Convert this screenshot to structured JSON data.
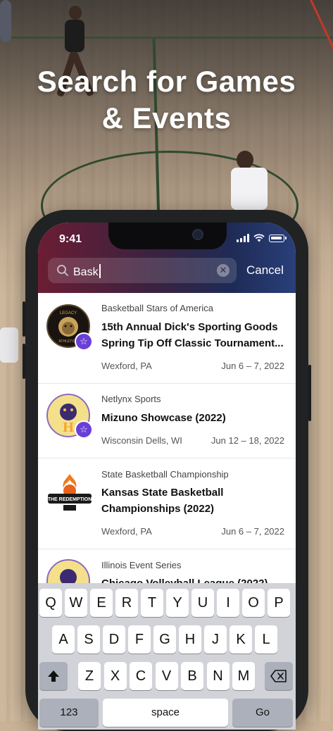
{
  "headline": {
    "line1": "Search for Games",
    "line2": "& Events"
  },
  "status_bar": {
    "time": "9:41"
  },
  "search": {
    "query": "Bask",
    "cancel_label": "Cancel"
  },
  "results": [
    {
      "organizer": "Basketball Stars of America",
      "title": "15th Annual Dick's Sporting Goods Spring Tip Off Classic Tournament...",
      "location": "Wexford, PA",
      "date": "Jun 6 – 7, 2022",
      "logo_text": "LEGACY ATHLETICS",
      "featured": true
    },
    {
      "organizer": "Netlynx Sports",
      "title": "Mizuno Showcase (2022)",
      "location": "Wisconsin Dells, WI",
      "date": "Jun 12 – 18, 2022",
      "logo_text": "H",
      "featured": true
    },
    {
      "organizer": "State Basketball Championship",
      "title": "Kansas State Basketball Championships (2022)",
      "location": "Wexford, PA",
      "date": "Jun 6 – 7, 2022",
      "logo_text": "THE REDEMPTION",
      "featured": false
    },
    {
      "organizer": "Illinois Event Series",
      "title": "Chicago Volleyball League (2022)",
      "location": "",
      "date": "",
      "logo_text": "",
      "featured": false
    }
  ],
  "keyboard": {
    "row1": [
      "Q",
      "W",
      "E",
      "R",
      "T",
      "Y",
      "U",
      "I",
      "O",
      "P"
    ],
    "row2": [
      "A",
      "S",
      "D",
      "F",
      "G",
      "H",
      "J",
      "K",
      "L"
    ],
    "row3": [
      "Z",
      "X",
      "C",
      "V",
      "B",
      "N",
      "M"
    ],
    "numbers_label": "123",
    "space_label": "space",
    "go_label": "Go",
    "shift_icon": "shift-icon",
    "delete_icon": "delete-icon"
  },
  "colors": {
    "accent_badge": "#6a3fd6",
    "headline": "#ffffff"
  }
}
